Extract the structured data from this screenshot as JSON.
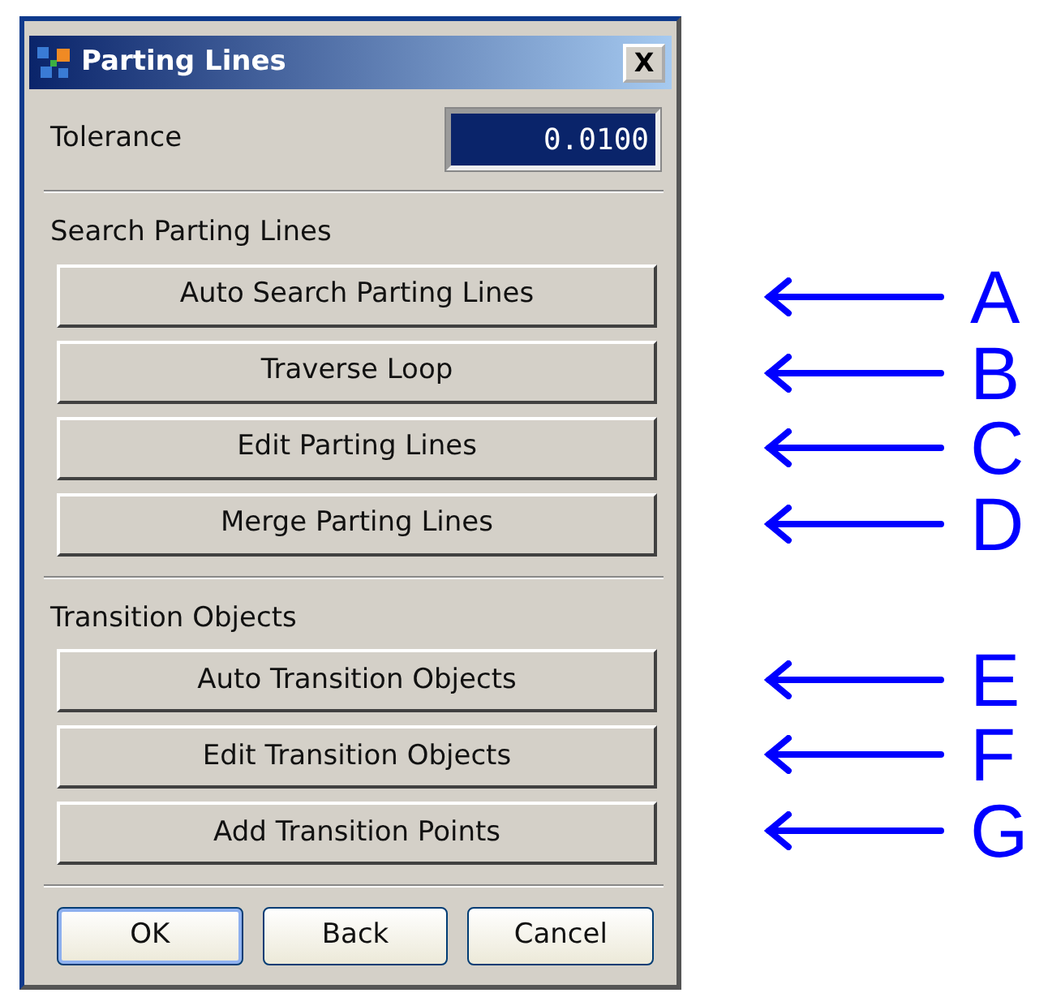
{
  "window": {
    "title": "Parting Lines",
    "close": "X"
  },
  "tolerance": {
    "label": "Tolerance",
    "value": "0.0100",
    "selected": true
  },
  "sections": [
    {
      "title": "Search Parting Lines",
      "buttons": [
        {
          "label": "Auto Search Parting Lines",
          "callout": "A"
        },
        {
          "label": "Traverse Loop",
          "callout": "B"
        },
        {
          "label": "Edit Parting Lines",
          "callout": "C"
        },
        {
          "label": "Merge Parting Lines",
          "callout": "D"
        }
      ]
    },
    {
      "title": "Transition Objects",
      "buttons": [
        {
          "label": "Auto Transition Objects",
          "callout": "E"
        },
        {
          "label": "Edit Transition Objects",
          "callout": "F"
        },
        {
          "label": "Add  Transition Points",
          "callout": "G"
        }
      ]
    }
  ],
  "footer_buttons": [
    {
      "label": "OK",
      "selected": true
    },
    {
      "label": "Back",
      "selected": false
    },
    {
      "label": "Cancel",
      "selected": false
    }
  ]
}
